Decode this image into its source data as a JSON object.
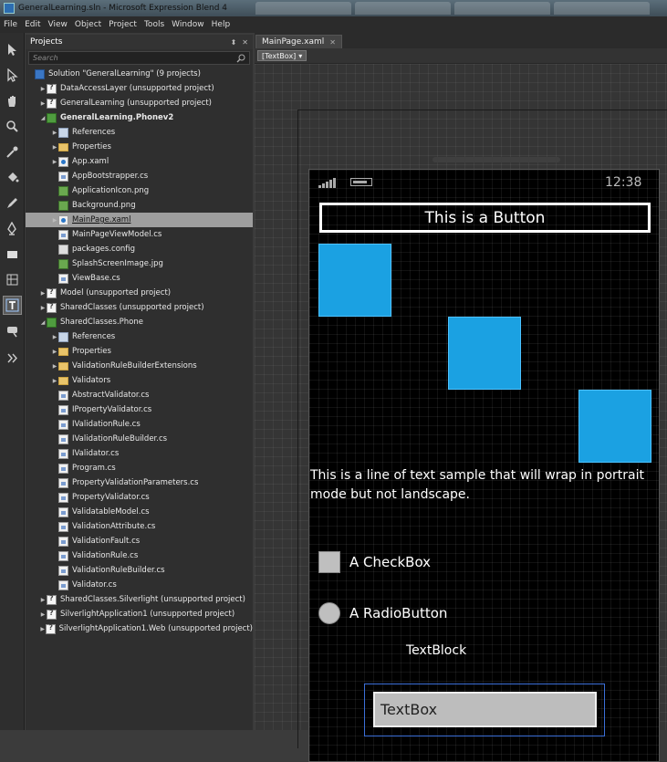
{
  "window": {
    "title": "GeneralLearning.sln - Microsoft Expression Blend 4"
  },
  "menu": [
    "File",
    "Edit",
    "View",
    "Object",
    "Project",
    "Tools",
    "Window",
    "Help"
  ],
  "toolbar": {
    "tools": [
      "selection-arrow-icon",
      "direct-select-icon",
      "pan-hand-icon",
      "zoom-icon",
      "eyedropper-icon",
      "paint-bucket-icon",
      "brush-icon",
      "pen-icon",
      "rectangle-icon",
      "grid-icon",
      "text-icon",
      "asset-tools-icon",
      "expand-icon"
    ],
    "active_tool": "text-icon"
  },
  "projects_panel": {
    "title": "Projects",
    "search_placeholder": "Search",
    "items": [
      {
        "label": "Solution \"GeneralLearning\" (9 projects)",
        "icon": "solution"
      },
      {
        "label": "DataAccessLayer (unsupported project)",
        "icon": "unsupported"
      },
      {
        "label": "GeneralLearning (unsupported project)",
        "icon": "unsupported"
      },
      {
        "label": "GeneralLearning.Phonev2",
        "icon": "project"
      },
      {
        "label": "References",
        "icon": "refs"
      },
      {
        "label": "Properties",
        "icon": "folder"
      },
      {
        "label": "App.xaml",
        "icon": "xaml"
      },
      {
        "label": "AppBootstrapper.cs",
        "icon": "cs"
      },
      {
        "label": "ApplicationIcon.png",
        "icon": "img"
      },
      {
        "label": "Background.png",
        "icon": "img"
      },
      {
        "label": "MainPage.xaml",
        "icon": "xaml"
      },
      {
        "label": "MainPageViewModel.cs",
        "icon": "cs"
      },
      {
        "label": "packages.config",
        "icon": "config"
      },
      {
        "label": "SplashScreenImage.jpg",
        "icon": "img"
      },
      {
        "label": "ViewBase.cs",
        "icon": "cs"
      },
      {
        "label": "Model (unsupported project)",
        "icon": "unsupported"
      },
      {
        "label": "SharedClasses (unsupported project)",
        "icon": "unsupported"
      },
      {
        "label": "SharedClasses.Phone",
        "icon": "project"
      },
      {
        "label": "References",
        "icon": "refs"
      },
      {
        "label": "Properties",
        "icon": "folder"
      },
      {
        "label": "ValidationRuleBuilderExtensions",
        "icon": "folder"
      },
      {
        "label": "Validators",
        "icon": "folder"
      },
      {
        "label": "AbstractValidator.cs",
        "icon": "cs"
      },
      {
        "label": "IPropertyValidator.cs",
        "icon": "cs"
      },
      {
        "label": "IValidationRule.cs",
        "icon": "cs"
      },
      {
        "label": "IValidationRuleBuilder.cs",
        "icon": "cs"
      },
      {
        "label": "IValidator.cs",
        "icon": "cs"
      },
      {
        "label": "Program.cs",
        "icon": "cs"
      },
      {
        "label": "PropertyValidationParameters.cs",
        "icon": "cs"
      },
      {
        "label": "PropertyValidator.cs",
        "icon": "cs"
      },
      {
        "label": "ValidatableModel.cs",
        "icon": "cs"
      },
      {
        "label": "ValidationAttribute.cs",
        "icon": "cs"
      },
      {
        "label": "ValidationFault.cs",
        "icon": "cs"
      },
      {
        "label": "ValidationRule.cs",
        "icon": "cs"
      },
      {
        "label": "ValidationRuleBuilder.cs",
        "icon": "cs"
      },
      {
        "label": "Validator.cs",
        "icon": "cs"
      },
      {
        "label": "SharedClasses.Silverlight (unsupported project)",
        "icon": "unsupported"
      },
      {
        "label": "SilverlightApplication1 (unsupported project)",
        "icon": "unsupported"
      },
      {
        "label": "SilverlightApplication1.Web (unsupported project)",
        "icon": "unsupported"
      }
    ],
    "selected_item": "MainPage.xaml"
  },
  "document": {
    "tab_label": "MainPage.xaml",
    "breadcrumb": "[TextBox]"
  },
  "phone": {
    "clock": "12:38",
    "button_label": "This is a Button",
    "wrap_text": "This is a line of text sample that will wrap in portrait mode but not landscape.",
    "checkbox_label": "A CheckBox",
    "radio_label": "A RadioButton",
    "textblock_text": "TextBlock",
    "textbox_text": "TextBox",
    "accent_color": "#1ba1e2"
  }
}
